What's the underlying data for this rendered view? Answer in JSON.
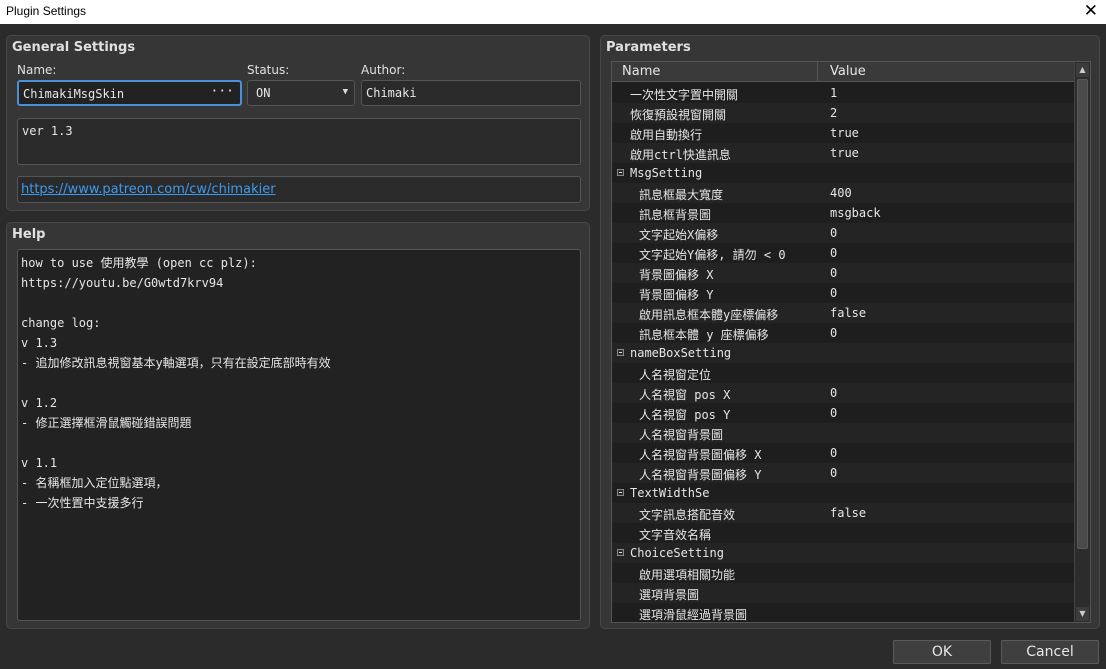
{
  "window": {
    "title": "Plugin Settings",
    "close_glyph": "✕"
  },
  "general": {
    "title": "General Settings",
    "name_label": "Name:",
    "name_value": "ChimakiMsgSkin",
    "name_button": "···",
    "status_label": "Status:",
    "status_value": "ON",
    "author_label": "Author:",
    "author_value": "Chimaki",
    "description": "ver 1.3",
    "url": "https://www.patreon.com/cw/chimakier"
  },
  "help": {
    "title": "Help",
    "text": "how to use 使用教學 (open cc plz):\nhttps://youtu.be/G0wtd7krv94\n\nchange log:\nv 1.3\n- 追加修改訊息視窗基本y軸選項，只有在設定底部時有效\n\nv 1.2\n- 修正選擇框滑鼠觸碰錯誤問題\n\nv 1.1\n- 名稱框加入定位點選項，\n- 一次性置中支援多行"
  },
  "parameters": {
    "title": "Parameters",
    "col_name": "Name",
    "col_value": "Value",
    "rows": [
      {
        "name": "一次性文字置中開關",
        "value": "1",
        "level": 1
      },
      {
        "name": "恢復預設視窗開關",
        "value": "2",
        "level": 1
      },
      {
        "name": "啟用自動換行",
        "value": "true",
        "level": 1
      },
      {
        "name": "啟用ctrl快進訊息",
        "value": "true",
        "level": 1
      },
      {
        "name": "MsgSetting",
        "value": "",
        "level": 0,
        "group": true
      },
      {
        "name": "訊息框最大寬度",
        "value": "400",
        "level": 2
      },
      {
        "name": "訊息框背景圖",
        "value": "msgback",
        "level": 2
      },
      {
        "name": "文字起始X偏移",
        "value": "0",
        "level": 2
      },
      {
        "name": "文字起始Y偏移, 請勿 < 0",
        "value": "0",
        "level": 2
      },
      {
        "name": "背景圖偏移 X",
        "value": "0",
        "level": 2
      },
      {
        "name": "背景圖偏移 Y",
        "value": "0",
        "level": 2
      },
      {
        "name": "啟用訊息框本體y座標偏移",
        "value": "false",
        "level": 2
      },
      {
        "name": "訊息框本體 y 座標偏移",
        "value": "0",
        "level": 2
      },
      {
        "name": "nameBoxSetting",
        "value": "",
        "level": 0,
        "group": true
      },
      {
        "name": "人名視窗定位",
        "value": "",
        "level": 2
      },
      {
        "name": "人名視窗 pos X",
        "value": "0",
        "level": 2
      },
      {
        "name": "人名視窗 pos Y",
        "value": "0",
        "level": 2
      },
      {
        "name": "人名視窗背景圖",
        "value": "",
        "level": 2
      },
      {
        "name": "人名視窗背景圖偏移 X",
        "value": "0",
        "level": 2
      },
      {
        "name": "人名視窗背景圖偏移 Y",
        "value": "0",
        "level": 2
      },
      {
        "name": "TextWidthSe",
        "value": "",
        "level": 0,
        "group": true
      },
      {
        "name": "文字訊息搭配音效",
        "value": "false",
        "level": 2
      },
      {
        "name": "文字音效名稱",
        "value": "",
        "level": 2
      },
      {
        "name": "ChoiceSetting",
        "value": "",
        "level": 0,
        "group": true
      },
      {
        "name": "啟用選項相關功能",
        "value": "",
        "level": 2
      },
      {
        "name": "選項背景圖",
        "value": "",
        "level": 2
      },
      {
        "name": "選項滑鼠經過背景圖",
        "value": "",
        "level": 2
      }
    ]
  },
  "footer": {
    "ok": "OK",
    "cancel": "Cancel"
  }
}
